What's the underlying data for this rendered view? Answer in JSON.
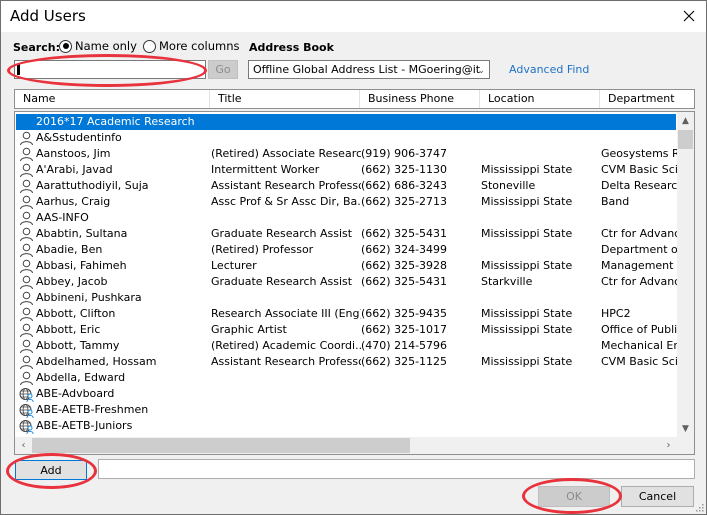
{
  "window": {
    "title": "Add Users",
    "close_icon": "close-icon"
  },
  "search": {
    "label": "Search:",
    "options": [
      {
        "label": "Name only",
        "checked": true
      },
      {
        "label": "More columns",
        "checked": false
      }
    ],
    "input_value": "",
    "go_label": "Go"
  },
  "address_book": {
    "label": "Address Book",
    "selected": "Offline Global Address List - MGoering@it",
    "advanced_find": "Advanced Find"
  },
  "columns": [
    "Name",
    "Title",
    "Business Phone",
    "Location",
    "Department"
  ],
  "rows": [
    {
      "icon": "group",
      "name": "2016*17 Academic Research",
      "title": "",
      "phone": "",
      "location": "",
      "department": "",
      "selected": true
    },
    {
      "icon": "person",
      "name": "A&Sstudentinfo",
      "title": "",
      "phone": "",
      "location": "",
      "department": ""
    },
    {
      "icon": "person",
      "name": "Aanstoos, Jim",
      "title": "(Retired) Associate Researc...",
      "phone": "(919) 906-3747",
      "location": "",
      "department": "Geosystems Re"
    },
    {
      "icon": "person",
      "name": "A'Arabi, Javad",
      "title": "Intermittent Worker",
      "phone": "(662) 325-1130",
      "location": "Mississippi State",
      "department": "CVM Basic Scie"
    },
    {
      "icon": "person",
      "name": "Aarattuthodiyil, Suja",
      "title": "Assistant Research Professor",
      "phone": "(662) 686-3243",
      "location": "Stoneville",
      "department": "Delta Research"
    },
    {
      "icon": "person",
      "name": "Aarhus, Craig",
      "title": "Assc Prof & Sr Assc Dir, Ba...",
      "phone": "(662) 325-2713",
      "location": "Mississippi State",
      "department": "Band"
    },
    {
      "icon": "person",
      "name": "AAS-INFO",
      "title": "",
      "phone": "",
      "location": "",
      "department": ""
    },
    {
      "icon": "person",
      "name": "Ababtin, Sultana",
      "title": "Graduate Research Assist",
      "phone": "(662) 325-5431",
      "location": "Mississippi State",
      "department": "Ctr for Advance"
    },
    {
      "icon": "person",
      "name": "Abadie, Ben",
      "title": "(Retired) Professor",
      "phone": "(662) 324-3499",
      "location": "",
      "department": "Department of"
    },
    {
      "icon": "person",
      "name": "Abbasi, Fahimeh",
      "title": "Lecturer",
      "phone": "(662) 325-3928",
      "location": "Mississippi State",
      "department": "Management &"
    },
    {
      "icon": "person",
      "name": "Abbey, Jacob",
      "title": "Graduate Research Assist",
      "phone": "(662) 325-5431",
      "location": "Starkville",
      "department": "Ctr for Advance"
    },
    {
      "icon": "person",
      "name": "Abbineni, Pushkara",
      "title": "",
      "phone": "",
      "location": "",
      "department": ""
    },
    {
      "icon": "person",
      "name": "Abbott, Clifton",
      "title": "Research Associate III (Eng)",
      "phone": "(662) 325-9435",
      "location": "Mississippi State",
      "department": "HPC2"
    },
    {
      "icon": "person",
      "name": "Abbott, Eric",
      "title": "Graphic Artist",
      "phone": "(662) 325-1017",
      "location": "Mississippi State",
      "department": "Office of Publi"
    },
    {
      "icon": "person",
      "name": "Abbott, Tammy",
      "title": "(Retired) Academic Coordi...",
      "phone": "(470) 214-5796",
      "location": "",
      "department": "Mechanical Eng"
    },
    {
      "icon": "person",
      "name": "Abdelhamed, Hossam",
      "title": "Assistant Research Professor",
      "phone": "(662) 325-1125",
      "location": "Mississippi State",
      "department": "CVM Basic Scie"
    },
    {
      "icon": "person",
      "name": "Abdella, Edward",
      "title": "",
      "phone": "",
      "location": "",
      "department": ""
    },
    {
      "icon": "distribution-list",
      "name": "ABE-Advboard",
      "title": "",
      "phone": "",
      "location": "",
      "department": ""
    },
    {
      "icon": "distribution-list",
      "name": "ABE-AETB-Freshmen",
      "title": "",
      "phone": "",
      "location": "",
      "department": ""
    },
    {
      "icon": "distribution-list",
      "name": "ABE-AETB-Juniors",
      "title": "",
      "phone": "",
      "location": "",
      "department": ""
    }
  ],
  "footer": {
    "add_label": "Add",
    "add_input_value": "",
    "ok_label": "OK",
    "cancel_label": "Cancel"
  },
  "colors": {
    "selection": "#0078d7",
    "link": "#1e73c8",
    "annotation": "#e8323c"
  }
}
